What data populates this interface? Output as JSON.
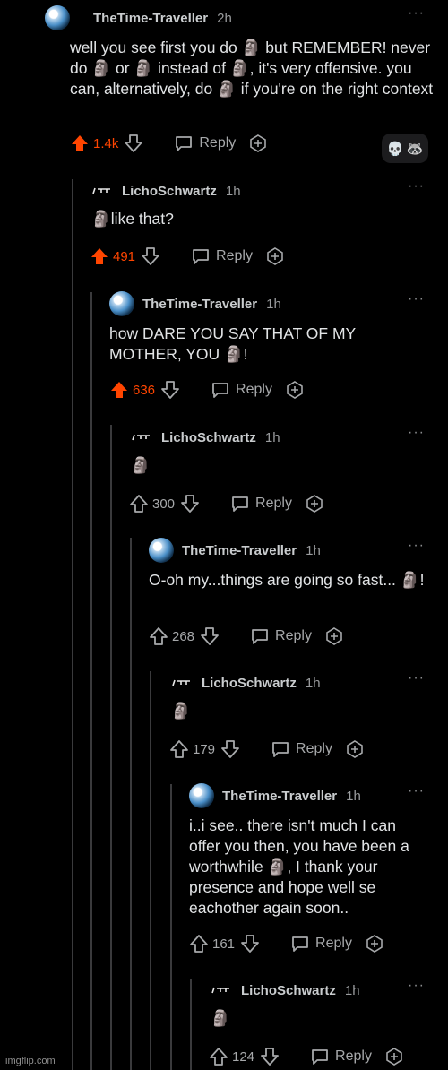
{
  "comments": [
    {
      "author": "TheTime-Traveller",
      "time": "2h",
      "text": "well you see first you do 🗿 but REMEMBER! never do 🗿 or 🗿 instead of 🗿, it's very offensive. you can, alternatively, do 🗿 if you're on the right context",
      "score": "1.4k",
      "upvoted": true,
      "reply_label": "Reply",
      "awards": [
        "💀",
        "🦝"
      ]
    },
    {
      "author": "LichoSchwartz",
      "time": "1h",
      "text": "🗿like that?",
      "score": "491",
      "upvoted": true,
      "reply_label": "Reply"
    },
    {
      "author": "TheTime-Traveller",
      "time": "1h",
      "text": "how DARE YOU SAY THAT OF MY MOTHER, YOU 🗿!",
      "score": "636",
      "upvoted": true,
      "reply_label": "Reply"
    },
    {
      "author": "LichoSchwartz",
      "time": "1h",
      "text": "🗿",
      "score": "300",
      "upvoted": false,
      "reply_label": "Reply"
    },
    {
      "author": "TheTime-Traveller",
      "time": "1h",
      "text": "O-oh my...things are going so fast... 🗿!",
      "score": "268",
      "upvoted": false,
      "reply_label": "Reply"
    },
    {
      "author": "LichoSchwartz",
      "time": "1h",
      "text": "🗿",
      "score": "179",
      "upvoted": false,
      "reply_label": "Reply"
    },
    {
      "author": "TheTime-Traveller",
      "time": "1h",
      "text": "i..i see.. there isn't much I can offer you then, you have been a worthwhile 🗿, I thank your presence and hope well se eachother again soon..",
      "score": "161",
      "upvoted": false,
      "reply_label": "Reply"
    },
    {
      "author": "LichoSchwartz",
      "time": "1h",
      "text": "🗿",
      "score": "124",
      "upvoted": false,
      "reply_label": "Reply"
    }
  ],
  "more_glyph": "···",
  "colors": {
    "upvote": "#ff4500",
    "background": "#000000",
    "thread_line": "#3a3a3c"
  },
  "watermark": "imgflip.com"
}
